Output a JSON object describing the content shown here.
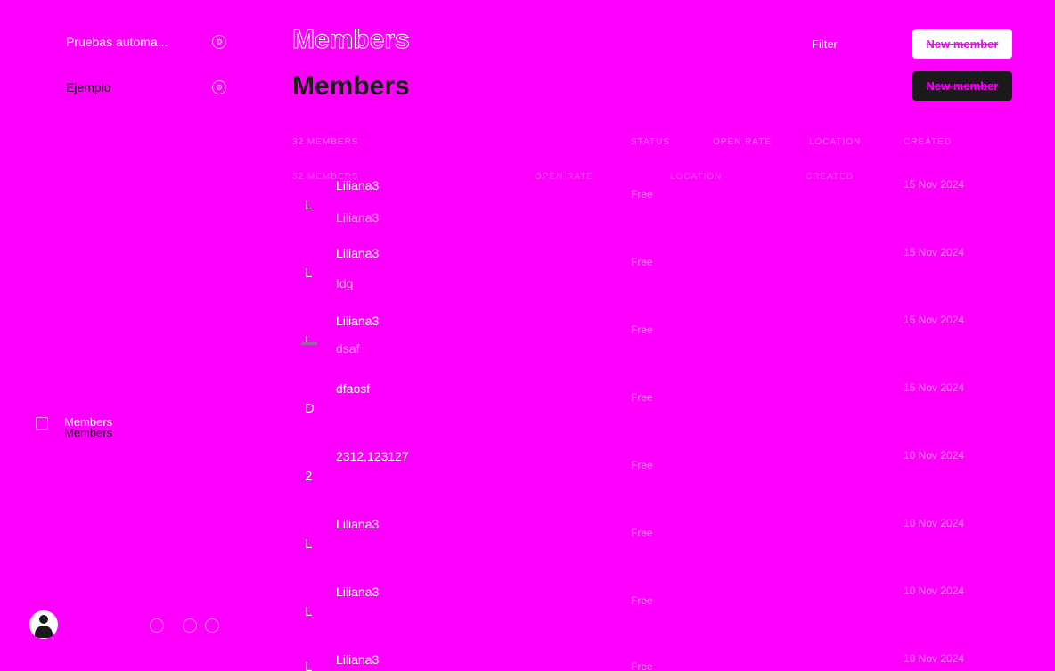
{
  "sidebar": {
    "sites": [
      {
        "label": "Pruebas automa..."
      },
      {
        "label": "Ejemplo"
      }
    ],
    "nav": {
      "label": "Members",
      "label_shadow": "Members"
    }
  },
  "header": {
    "title": "Members",
    "title_shadow": "Members",
    "filter_label": "Filter",
    "new_member_label": "New member",
    "new_member_label_dark": "New member",
    "ghost_label": "bers"
  },
  "table": {
    "columns": [
      "32 MEMBERS",
      "STATUS",
      "OPEN RATE",
      "LOCATION",
      "CREATED"
    ],
    "ghost_columns": [
      "32 MEMBERS",
      "OPEN RATE",
      "LOCATION",
      "CREATED"
    ],
    "rows": [
      {
        "initial": "L",
        "name": "Liliana3",
        "sub": "Liliana3",
        "status": "Free",
        "date": "15 Nov 2024"
      },
      {
        "initial": "L",
        "name": "Liliana3",
        "sub": "fdg",
        "status": "Free",
        "date": "15 Nov 2024"
      },
      {
        "initial": "L",
        "name": "Liliana3",
        "sub": "dsaf",
        "status": "Free",
        "date": "15 Nov 2024"
      },
      {
        "initial": "D",
        "name": "dfaosf",
        "sub": "",
        "status": "Free",
        "date": "15 Nov 2024"
      },
      {
        "initial": "2",
        "name": "2312.123127",
        "sub": "",
        "status": "Free",
        "date": "10 Nov 2024"
      },
      {
        "initial": "L",
        "name": "Liliana3",
        "sub": "",
        "status": "Free",
        "date": "10 Nov 2024"
      },
      {
        "initial": "L",
        "name": "Liliana3",
        "sub": "",
        "status": "Free",
        "date": "10 Nov 2024"
      },
      {
        "initial": "L",
        "name": "Liliana3",
        "sub": "",
        "status": "Free",
        "date": "10 Nov 2024"
      }
    ]
  }
}
